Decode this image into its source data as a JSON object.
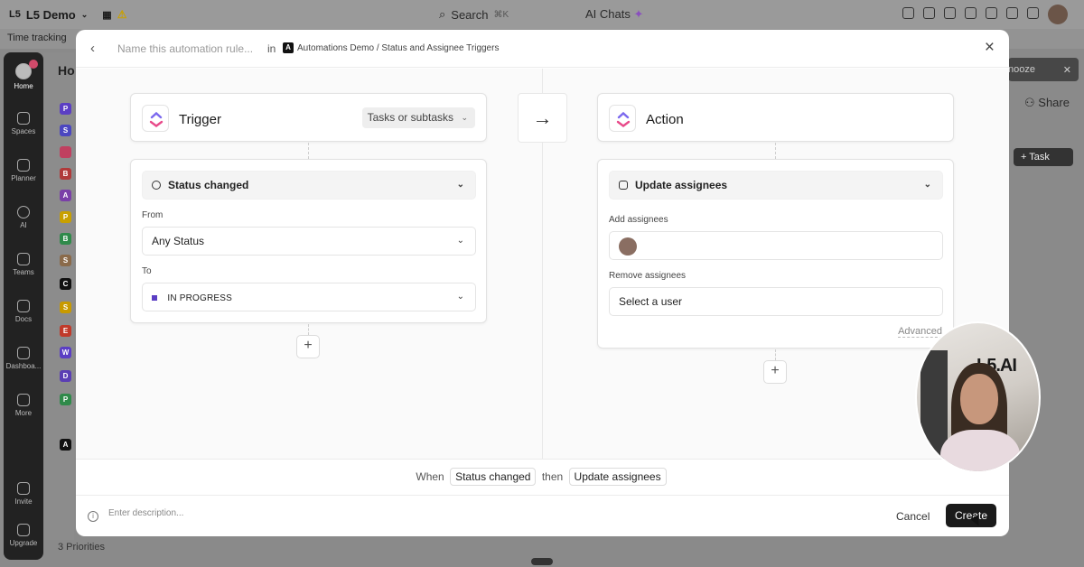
{
  "app": {
    "workspace": "L5 Demo",
    "workspace_logo": "L5",
    "search_label": "Search",
    "search_shortcut": "⌘K",
    "ai_chats": "AI Chats",
    "time_tracking": "Time tracking",
    "home_heading": "Ho",
    "priorities": "3 Priorities",
    "snooze": "nooze",
    "share": "Share",
    "task": "Task"
  },
  "rail": {
    "items": [
      "Home",
      "Spaces",
      "Planner",
      "AI",
      "Teams",
      "Docs",
      "Dashboa...",
      "More",
      "Invite",
      "Upgrade"
    ]
  },
  "spaces": [
    "P",
    "S",
    "",
    "B",
    "A",
    "P",
    "B",
    "S",
    "C",
    "S",
    "E",
    "W",
    "D",
    "P",
    "",
    "A"
  ],
  "modal": {
    "rule_name_placeholder": "Name this automation rule...",
    "in_label": "in",
    "path_icon": "A",
    "path": "Automations Demo / Status and Assignee Triggers",
    "trigger": {
      "title": "Trigger",
      "scope": "Tasks or subtasks",
      "event": "Status changed",
      "from_label": "From",
      "from_value": "Any Status",
      "to_label": "To",
      "to_value": "IN PROGRESS"
    },
    "action": {
      "title": "Action",
      "event": "Update assignees",
      "add_label": "Add assignees",
      "remove_label": "Remove assignees",
      "remove_placeholder": "Select a user",
      "advanced": "Advanced"
    },
    "summary": {
      "when": "When",
      "trigger_chip": "Status changed",
      "then": "then",
      "action_chip": "Update assignees"
    },
    "footer": {
      "description_placeholder": "Enter description...",
      "cancel": "Cancel",
      "create": "Create"
    }
  },
  "webcam": {
    "brand_text": "L5.AI"
  },
  "colors": {
    "status_in_progress": "#5b3ec4",
    "primary_button": "#1a1a1a"
  }
}
